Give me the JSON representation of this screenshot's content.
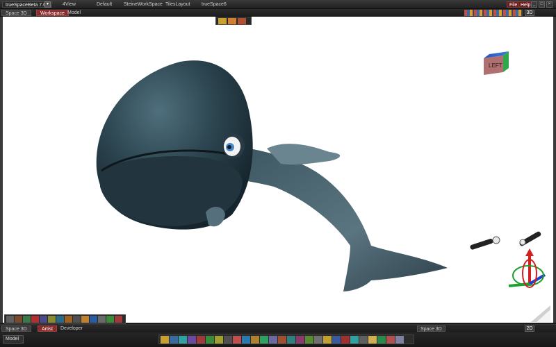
{
  "window": {
    "app_title": "trueSpaceBeta 7.61",
    "layouts": [
      "4View",
      "Default",
      "SteineWorkSpace",
      "TilesLayout",
      "trueSpace6"
    ],
    "menu": {
      "file": "File",
      "help": "Help"
    }
  },
  "tabs": {
    "space": "Space 3D",
    "items": [
      "Workspace",
      "Model"
    ],
    "active": "Workspace",
    "mode": "3D"
  },
  "viewport": {
    "navigation_cube_label": "LEFT",
    "scene": "3D whale model",
    "background": "#ffffff"
  },
  "bottom_tabs": {
    "space": "Space 3D",
    "items": [
      "Artist",
      "Developer"
    ],
    "active": "Artist",
    "right_space": "Space 3D",
    "mode": "2D"
  },
  "status": {
    "context": "Model"
  },
  "colors": {
    "accent": "#8a2b2b",
    "chrome": "#222222",
    "whale_body": "#2f4a55",
    "whale_belly": "#2a3d47"
  }
}
